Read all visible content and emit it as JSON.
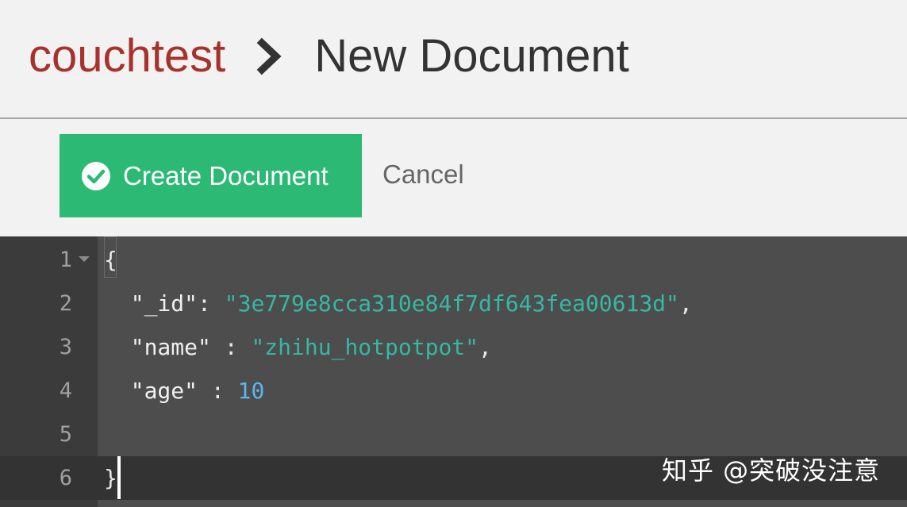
{
  "breadcrumb": {
    "database": "couchtest",
    "current": "New Document"
  },
  "toolbar": {
    "create_label": "Create Document",
    "cancel_label": "Cancel"
  },
  "colors": {
    "accent_green": "#2cb974",
    "database_red": "#a8322b",
    "editor_bg": "#4d4d4d",
    "string": "#35b8a4",
    "number": "#5bb6f0"
  },
  "editor": {
    "lines": [
      {
        "number": "1",
        "tokens": [
          {
            "text": "{",
            "kind": "punct"
          }
        ]
      },
      {
        "number": "2",
        "tokens": [
          {
            "text": "  \"_id\"",
            "kind": "key"
          },
          {
            "text": ": ",
            "kind": "punct"
          },
          {
            "text": "\"3e779e8cca310e84f7df643fea00613d\"",
            "kind": "str"
          },
          {
            "text": ",",
            "kind": "punct"
          }
        ]
      },
      {
        "number": "3",
        "tokens": [
          {
            "text": "  \"name\"",
            "kind": "key"
          },
          {
            "text": " : ",
            "kind": "punct"
          },
          {
            "text": "\"zhihu_hotpotpot\"",
            "kind": "str"
          },
          {
            "text": ",",
            "kind": "punct"
          }
        ]
      },
      {
        "number": "4",
        "tokens": [
          {
            "text": "  \"age\"",
            "kind": "key"
          },
          {
            "text": " : ",
            "kind": "punct"
          },
          {
            "text": "10",
            "kind": "num"
          }
        ]
      },
      {
        "number": "5",
        "tokens": []
      },
      {
        "number": "6",
        "tokens": [
          {
            "text": "}",
            "kind": "punct"
          }
        ]
      }
    ]
  },
  "watermark": "知乎 @突破没注意"
}
